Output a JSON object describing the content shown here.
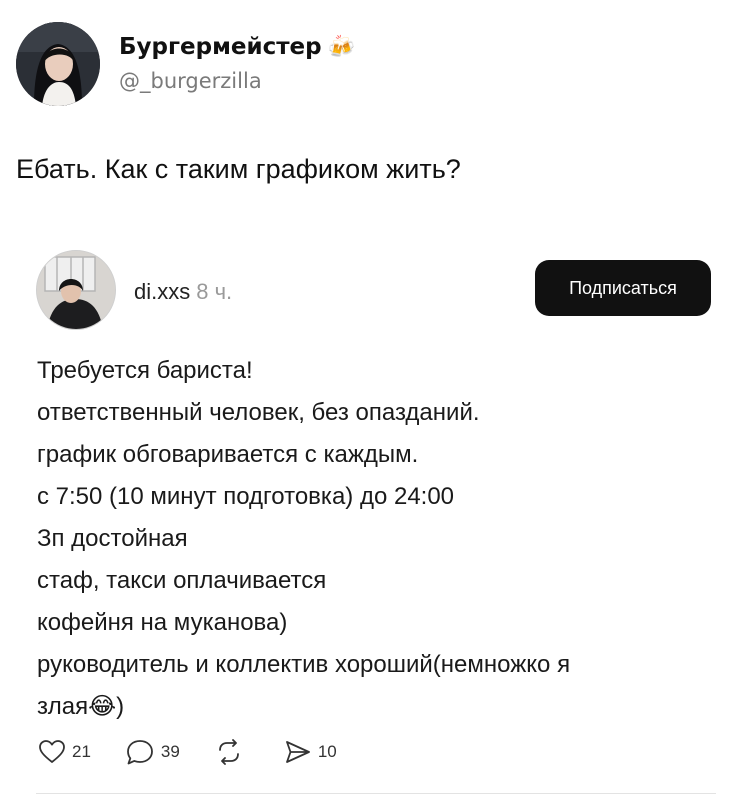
{
  "tweet": {
    "display_name": "Бургермейстер",
    "name_emoji": "🍻",
    "handle": "@_burgerzilla",
    "text": "Ебать. Как с таким графиком жить?"
  },
  "quoted_post": {
    "username": "di.xxs",
    "time": "8 ч.",
    "follow_label": "Подписаться",
    "lines": [
      "Требуется бариста!",
      "ответственный человек, без опазданий.",
      "график обговаривается с каждым.",
      "с 7:50 (10 минут подготовка) до 24:00",
      "Зп достойная",
      "стаф, такси оплачивается",
      "кофейня на муканова)",
      "руководитель и коллектив хороший(немножко я",
      "злая😂)"
    ],
    "actions": {
      "likes": "21",
      "comments": "39",
      "reposts": "",
      "shares": "10"
    }
  }
}
